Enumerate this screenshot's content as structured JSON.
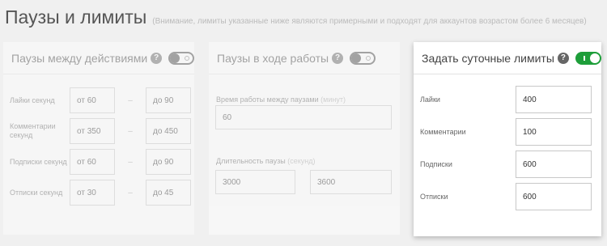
{
  "header": {
    "title": "Паузы и лимиты",
    "note": "(Внимание, лимиты указанные ниже являются примерными и подходят для аккаунтов возрастом более 6 месяцев)"
  },
  "cards": {
    "action_pauses": {
      "title": "Паузы между действиями",
      "help": "?",
      "enabled": false,
      "dash": "–",
      "rows": [
        {
          "label": "Лайки секунд",
          "from": "от 60",
          "to": "до 90"
        },
        {
          "label": "Комментарии секунд",
          "from": "от 350",
          "to": "до 450"
        },
        {
          "label": "Подписки секунд",
          "from": "от 60",
          "to": "до 90"
        },
        {
          "label": "Отписки секунд",
          "from": "от 30",
          "to": "до 45"
        }
      ]
    },
    "work_pauses": {
      "title": "Паузы в ходе работы",
      "help": "?",
      "enabled": false,
      "work_time_label": "Время работы между паузами",
      "work_time_unit": "(минут)",
      "work_time_value": "60",
      "pause_label": "Длительность паузы",
      "pause_unit": "(секунд)",
      "pause_from": "3000",
      "pause_to": "3600"
    },
    "daily_limits": {
      "title": "Задать суточные лимиты",
      "help": "?",
      "enabled": true,
      "rows": [
        {
          "label": "Лайки",
          "value": "400"
        },
        {
          "label": "Комментарии",
          "value": "100"
        },
        {
          "label": "Подписки",
          "value": "600"
        },
        {
          "label": "Отписки",
          "value": "600"
        }
      ]
    }
  },
  "colors": {
    "toggle_on": "#1e9e3a",
    "background": "#f0f0f0"
  }
}
